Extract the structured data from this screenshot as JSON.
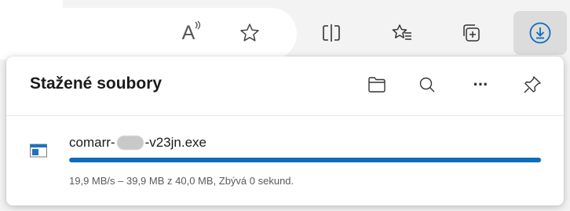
{
  "toolbar": {
    "buttons": [
      {
        "icon": "read-aloud-icon"
      },
      {
        "icon": "favorite-star-icon"
      },
      {
        "icon": "split-screen-icon"
      },
      {
        "icon": "favorites-list-icon"
      },
      {
        "icon": "collections-icon"
      },
      {
        "icon": "downloads-icon",
        "active": true
      }
    ],
    "read_aloud_glyph": "A",
    "accent_color": "#0f6cbd"
  },
  "downloads_panel": {
    "title": "Stažené soubory",
    "actions": [
      {
        "icon": "open-folder-icon"
      },
      {
        "icon": "search-icon"
      },
      {
        "icon": "more-options-icon",
        "glyph": "···"
      },
      {
        "icon": "pin-icon"
      }
    ],
    "items": [
      {
        "file_icon": "exe-file-icon",
        "file_name_prefix": "comarr-",
        "file_name_suffix": "-v23jn.exe",
        "progress_fraction": 0.998,
        "status": "19,9 MB/s – 39,9 MB z 40,0 MB, Zbývá 0 sekund."
      }
    ]
  }
}
